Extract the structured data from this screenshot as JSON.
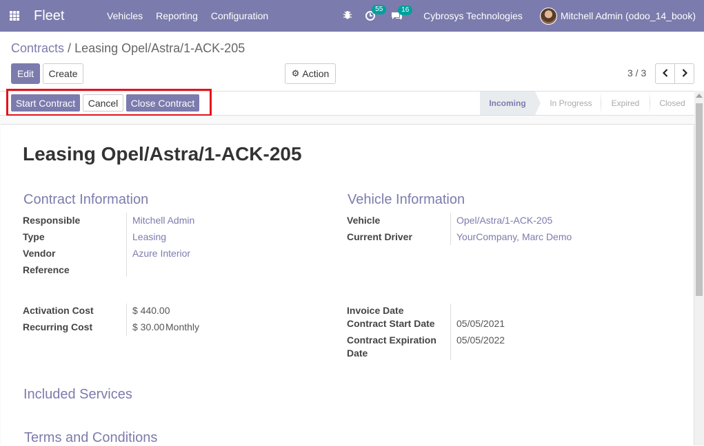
{
  "nav": {
    "app_name": "Fleet",
    "menus": [
      "Vehicles",
      "Reporting",
      "Configuration"
    ],
    "activity_count": "55",
    "message_count": "16",
    "company": "Cybrosys Technologies",
    "user": "Mitchell Admin (odoo_14_book)"
  },
  "breadcrumb": {
    "parent": "Contracts",
    "separator": "/",
    "current": "Leasing Opel/Astra/1-ACK-205"
  },
  "toolbar": {
    "edit": "Edit",
    "create": "Create",
    "action": "Action",
    "pager": "3 / 3"
  },
  "statusbar": {
    "buttons": {
      "start": "Start Contract",
      "cancel": "Cancel",
      "close": "Close Contract"
    },
    "stages": [
      "Incoming",
      "In Progress",
      "Expired",
      "Closed"
    ],
    "active_stage": "Incoming"
  },
  "record": {
    "title": "Leasing Opel/Astra/1-ACK-205",
    "contract_section": "Contract Information",
    "vehicle_section": "Vehicle Information",
    "responsible_label": "Responsible",
    "responsible": "Mitchell Admin",
    "type_label": "Type",
    "type": "Leasing",
    "vendor_label": "Vendor",
    "vendor": "Azure Interior",
    "reference_label": "Reference",
    "reference": "",
    "vehicle_label": "Vehicle",
    "vehicle": "Opel/Astra/1-ACK-205",
    "driver_label": "Current Driver",
    "driver": "YourCompany, Marc Demo",
    "activation_cost_label": "Activation Cost",
    "activation_cost": "$ 440.00",
    "recurring_cost_label": "Recurring Cost",
    "recurring_cost": "$ 30.00",
    "recurring_period": "Monthly",
    "invoice_date_label": "Invoice Date",
    "invoice_date": "",
    "start_date_label": "Contract Start Date",
    "start_date": "05/05/2021",
    "expiration_label_line1": "Contract Expiration",
    "expiration_label_line2": "Date",
    "expiration_date": "05/05/2022",
    "included_services": "Included Services",
    "terms": "Terms and Conditions"
  },
  "colors": {
    "brand": "#7c7bad",
    "highlight": "#e4131b",
    "badge": "#00a09d"
  }
}
